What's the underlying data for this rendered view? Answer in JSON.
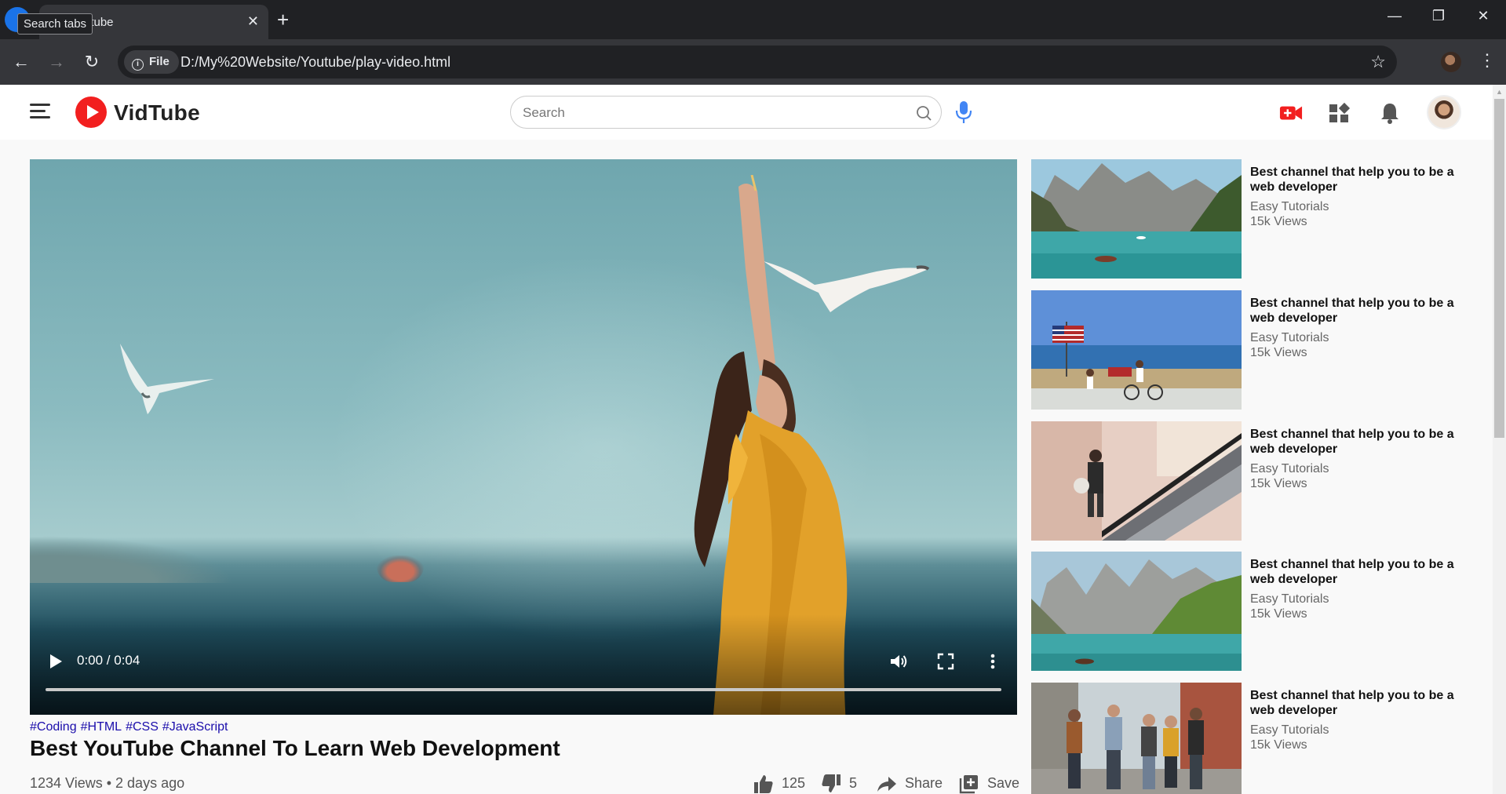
{
  "browser": {
    "tab_title": "Youtube",
    "tooltip": "Search tabs",
    "chip_label": "File",
    "url": "D:/My%20Website/Youtube/play-video.html"
  },
  "site": {
    "name": "VidTube",
    "search_placeholder": "Search",
    "accent_color": "#f21f1f"
  },
  "video": {
    "time": "0:00 / 0:04",
    "progress": 0,
    "tags": [
      "#Coding",
      "#HTML",
      "#CSS",
      "#JavaScript"
    ],
    "title": "Best YouTube Channel To Learn Web Development",
    "meta": "1234 Views • 2 days ago",
    "likes": "125",
    "dislikes": "5",
    "share_label": "Share",
    "save_label": "Save"
  },
  "sidebar": {
    "items": [
      {
        "title": "Best channel that help you to be a web developer",
        "channel": "Easy Tutorials",
        "views": "15k Views",
        "thumb": "lake-boat"
      },
      {
        "title": "Best channel that help you to be a web developer",
        "channel": "Easy Tutorials",
        "views": "15k Views",
        "thumb": "flag-beach"
      },
      {
        "title": "Best channel that help you to be a web developer",
        "channel": "Easy Tutorials",
        "views": "15k Views",
        "thumb": "escalator"
      },
      {
        "title": "Best channel that help you to be a web developer",
        "channel": "Easy Tutorials",
        "views": "15k Views",
        "thumb": "mountain-lake"
      },
      {
        "title": "Best channel that help you to be a web developer",
        "channel": "Easy Tutorials",
        "views": "15k Views",
        "thumb": "street-friends"
      }
    ]
  }
}
